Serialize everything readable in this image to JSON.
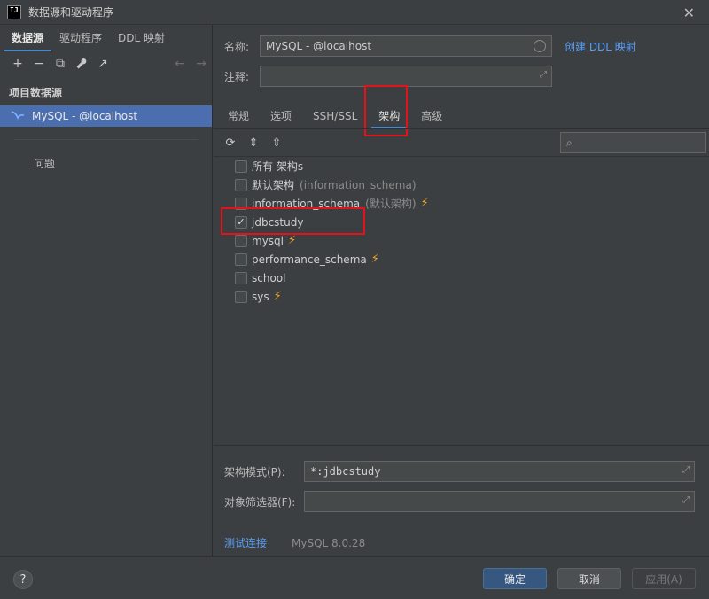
{
  "window": {
    "app_icon_text": "IJ",
    "title": "数据源和驱动程序",
    "close_glyph": "✕"
  },
  "left": {
    "tabs": [
      {
        "label": "数据源",
        "active": true
      },
      {
        "label": "驱动程序",
        "active": false
      },
      {
        "label": "DDL 映射",
        "active": false
      }
    ],
    "toolbar": {
      "add": "+",
      "remove": "−",
      "copy": "⧉",
      "settings": "🔧",
      "goto": "↗",
      "back": "←",
      "forward": "→"
    },
    "section": "项目数据源",
    "datasource": "MySQL - @localhost",
    "problems": "问题"
  },
  "form": {
    "name_label": "名称:",
    "name_value": "MySQL - @localhost",
    "create_ddl_link": "创建 DDL 映射",
    "comment_label": "注释:",
    "comment_value": ""
  },
  "tabs": [
    {
      "label": "常规",
      "active": false
    },
    {
      "label": "选项",
      "active": false
    },
    {
      "label": "SSH/SSL",
      "active": false
    },
    {
      "label": "架构",
      "active": true
    },
    {
      "label": "高级",
      "active": false
    }
  ],
  "schema_toolbar": {
    "refresh": "⟳",
    "expand": "⇕",
    "collapse": "⇳"
  },
  "search": {
    "placeholder": "",
    "icon": "⌕"
  },
  "schemas": [
    {
      "name": "所有 架构s",
      "hint": "",
      "checked": false,
      "bolt": false
    },
    {
      "name": "默认架构",
      "hint": "(information_schema)",
      "checked": false,
      "bolt": false
    },
    {
      "name": "information_schema",
      "hint": "(默认架构)",
      "checked": false,
      "bolt": true
    },
    {
      "name": "jdbcstudy",
      "hint": "",
      "checked": true,
      "bolt": false
    },
    {
      "name": "mysql",
      "hint": "",
      "checked": false,
      "bolt": true
    },
    {
      "name": "performance_schema",
      "hint": "",
      "checked": false,
      "bolt": true
    },
    {
      "name": "school",
      "hint": "",
      "checked": false,
      "bolt": false
    },
    {
      "name": "sys",
      "hint": "",
      "checked": false,
      "bolt": true
    }
  ],
  "bolt_glyph": "⚡",
  "check_glyph": "✓",
  "bottom": {
    "schema_pattern_label": "架构模式(P):",
    "schema_pattern_value": "*:jdbcstudy",
    "object_filter_label": "对象筛选器(F):",
    "object_filter_value": "",
    "expand_glyph": "⤢",
    "test_connection": "测试连接",
    "version": "MySQL 8.0.28"
  },
  "footer": {
    "help": "?",
    "ok": "确定",
    "cancel": "取消",
    "apply": "应用(A)"
  },
  "colors": {
    "accent": "#4a88c7",
    "selection": "#4b6eaf",
    "highlight": "#e0141a",
    "link": "#589df6",
    "bolt": "#f4a623"
  }
}
